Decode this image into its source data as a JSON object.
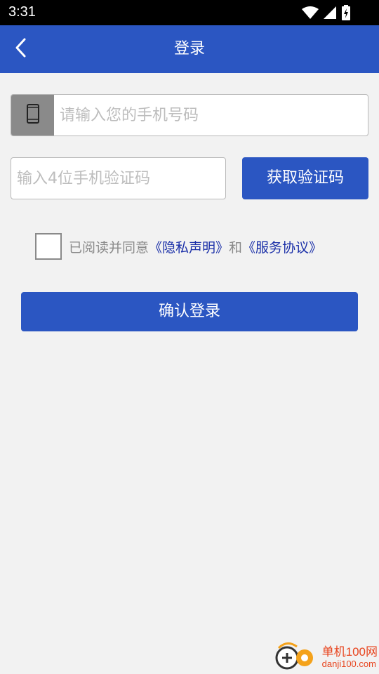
{
  "status_bar": {
    "time": "3:31",
    "icons": [
      "wifi-icon",
      "cell-signal-icon",
      "battery-charging-icon"
    ]
  },
  "app_bar": {
    "title": "登录",
    "back_icon": "chevron-left-icon"
  },
  "phone": {
    "icon": "mobile-phone-icon",
    "placeholder": "请输入您的手机号码",
    "value": ""
  },
  "code": {
    "placeholder": "输入4位手机验证码",
    "value": "",
    "get_code_label": "获取验证码"
  },
  "agreement": {
    "checked": false,
    "prefix": "已阅读并同意",
    "privacy_link": "《隐私声明》",
    "joiner": "和",
    "service_link": "《服务协议》"
  },
  "confirm_label": "确认登录",
  "watermark": {
    "name": "单机100网",
    "domain": "danji100.com"
  },
  "colors": {
    "primary": "#2b56c2",
    "background": "#f2f2f2",
    "link": "#1a2fa8",
    "watermark": "#e8451f"
  }
}
